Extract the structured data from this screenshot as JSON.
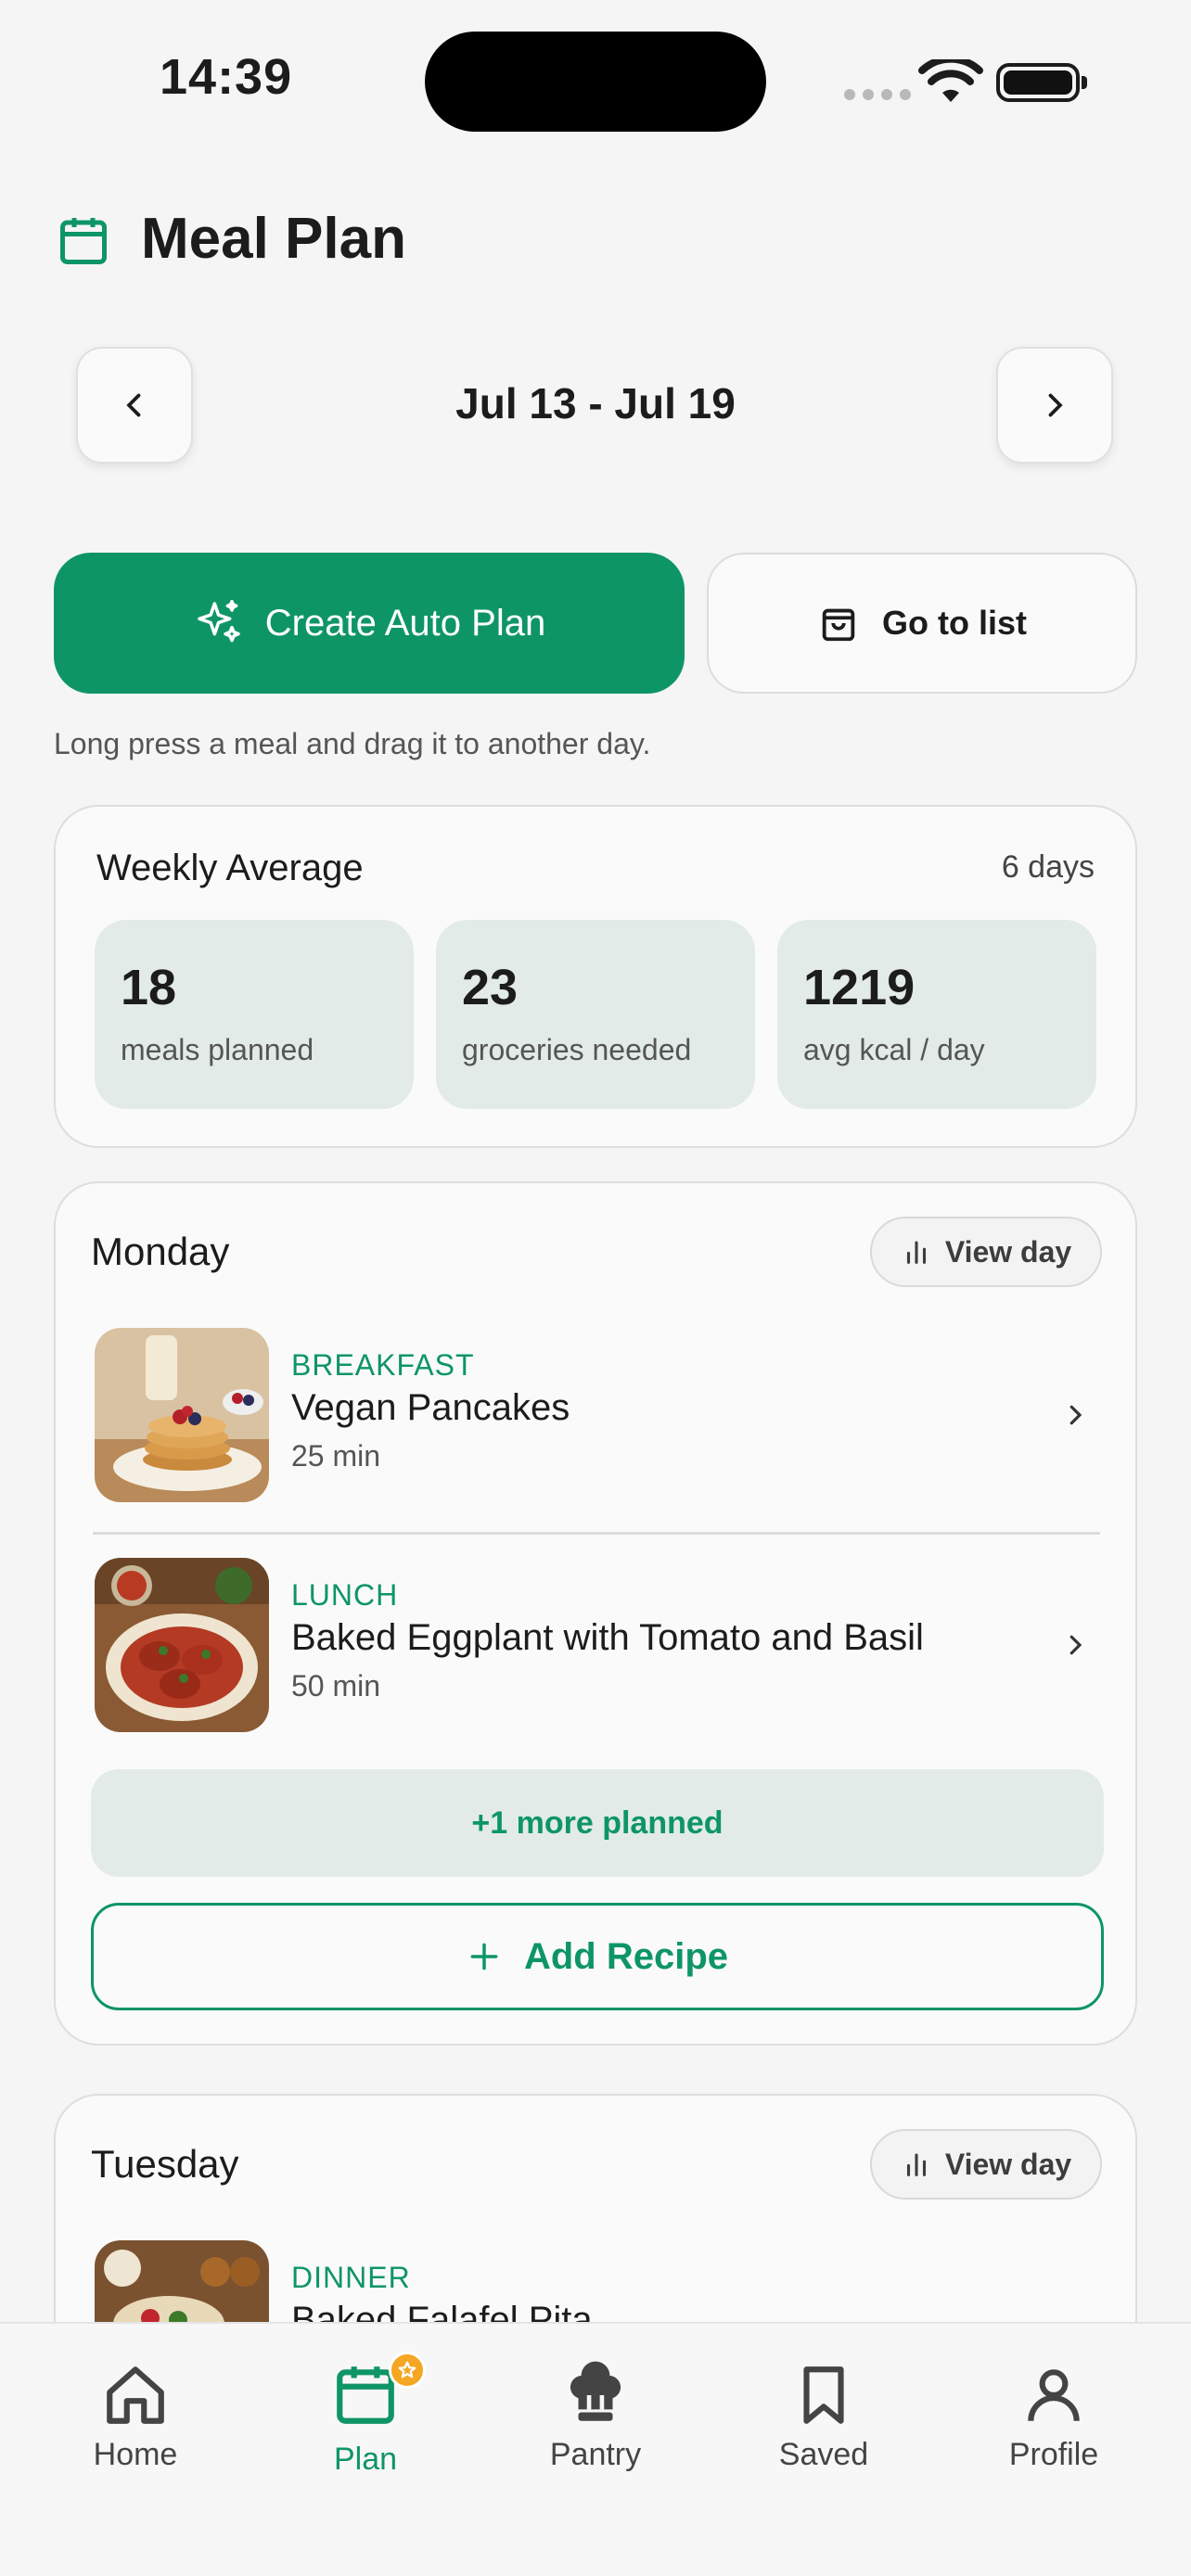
{
  "status_bar": {
    "time": "14:39"
  },
  "header": {
    "title": "Meal Plan"
  },
  "week_nav": {
    "range": "Jul 13 - Jul 19"
  },
  "actions": {
    "auto_plan_label": "Create Auto Plan",
    "go_to_list_label": "Go to list",
    "hint": "Long press a meal and drag it to another day."
  },
  "weekly_average": {
    "title": "Weekly Average",
    "days": "6 days",
    "stats": [
      {
        "value": "18",
        "label": "meals planned"
      },
      {
        "value": "23",
        "label": "groceries needed"
      },
      {
        "value": "1219",
        "label": "avg kcal / day"
      }
    ]
  },
  "days": [
    {
      "name": "Monday",
      "view_day_label": "View day",
      "meals": [
        {
          "type": "BREAKFAST",
          "name": "Vegan Pancakes",
          "time": "25 min"
        },
        {
          "type": "LUNCH",
          "name": "Baked Eggplant with Tomato and Basil",
          "time": "50 min"
        }
      ],
      "more_planned": "+1 more planned",
      "add_recipe_label": "Add Recipe"
    },
    {
      "name": "Tuesday",
      "view_day_label": "View day",
      "meals": [
        {
          "type": "DINNER",
          "name": "Baked Falafel Pita",
          "time": ""
        }
      ]
    }
  ],
  "tabbar": {
    "tabs": [
      {
        "label": "Home",
        "icon": "home-icon"
      },
      {
        "label": "Plan",
        "icon": "calendar-icon"
      },
      {
        "label": "Pantry",
        "icon": "chef-hat-icon"
      },
      {
        "label": "Saved",
        "icon": "bookmark-icon"
      },
      {
        "label": "Profile",
        "icon": "user-icon"
      }
    ],
    "active": "Plan"
  },
  "colors": {
    "accent": "#0e9566",
    "badge": "#f5a623"
  }
}
